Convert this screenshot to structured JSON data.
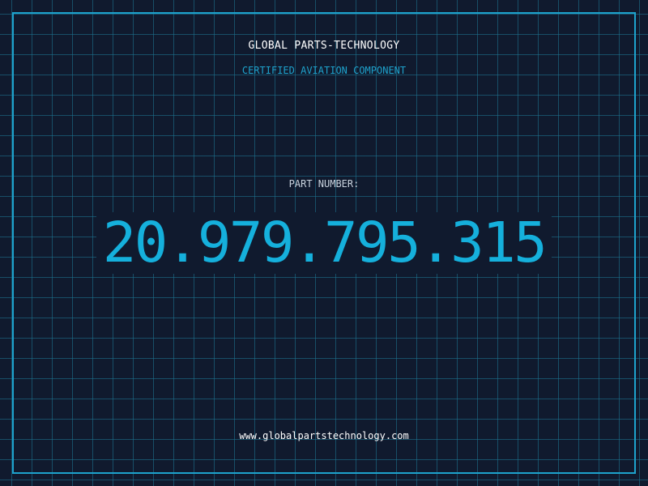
{
  "header": {
    "company_name": "GLOBAL PARTS-TECHNOLOGY",
    "subtitle": "CERTIFIED AVIATION COMPONENT"
  },
  "part": {
    "label": "PART NUMBER:",
    "number": "20.979.795.315"
  },
  "footer": {
    "website": "www.globalpartstechnology.com"
  },
  "colors": {
    "background": "#101a2e",
    "accent": "#1ea2cc",
    "part_number": "#15b0dc",
    "text": "#ffffff"
  }
}
